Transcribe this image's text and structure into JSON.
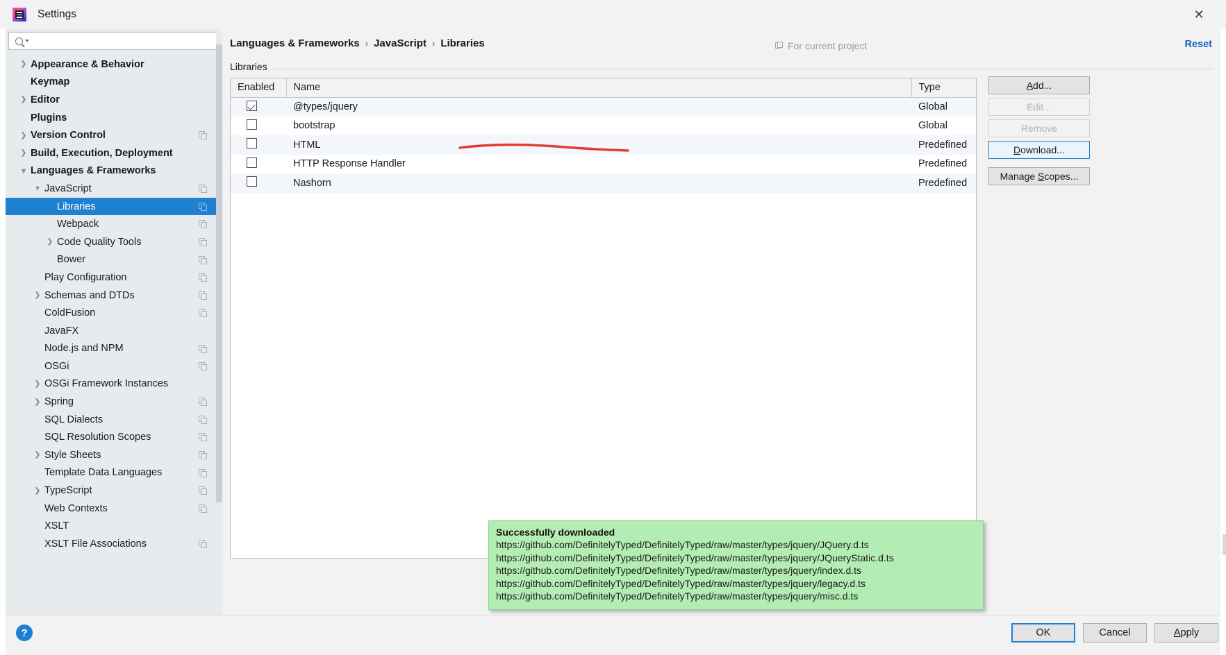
{
  "window": {
    "title": "Settings",
    "app_icon": "intellij-icon",
    "close_label": "✕"
  },
  "search": {
    "value": "",
    "placeholder": "",
    "icon": "search-icon"
  },
  "sidebar": {
    "items": [
      {
        "label": "Appearance & Behavior",
        "level": 0,
        "arrow": "closed",
        "selected": false,
        "module_icon": false
      },
      {
        "label": "Keymap",
        "level": 0,
        "arrow": "none",
        "selected": false,
        "module_icon": false
      },
      {
        "label": "Editor",
        "level": 0,
        "arrow": "closed",
        "selected": false,
        "module_icon": false
      },
      {
        "label": "Plugins",
        "level": 0,
        "arrow": "none",
        "selected": false,
        "module_icon": false
      },
      {
        "label": "Version Control",
        "level": 0,
        "arrow": "closed",
        "selected": false,
        "module_icon": true
      },
      {
        "label": "Build, Execution, Deployment",
        "level": 0,
        "arrow": "closed",
        "selected": false,
        "module_icon": false
      },
      {
        "label": "Languages & Frameworks",
        "level": 0,
        "arrow": "open",
        "selected": false,
        "module_icon": false
      },
      {
        "label": "JavaScript",
        "level": 1,
        "arrow": "open",
        "selected": false,
        "module_icon": true
      },
      {
        "label": "Libraries",
        "level": 2,
        "arrow": "none",
        "selected": true,
        "module_icon": true
      },
      {
        "label": "Webpack",
        "level": 2,
        "arrow": "none",
        "selected": false,
        "module_icon": true
      },
      {
        "label": "Code Quality Tools",
        "level": 2,
        "arrow": "closed",
        "selected": false,
        "module_icon": true
      },
      {
        "label": "Bower",
        "level": 2,
        "arrow": "none",
        "selected": false,
        "module_icon": true
      },
      {
        "label": "Play Configuration",
        "level": 1,
        "arrow": "none",
        "selected": false,
        "module_icon": true
      },
      {
        "label": "Schemas and DTDs",
        "level": 1,
        "arrow": "closed",
        "selected": false,
        "module_icon": true
      },
      {
        "label": "ColdFusion",
        "level": 1,
        "arrow": "none",
        "selected": false,
        "module_icon": true
      },
      {
        "label": "JavaFX",
        "level": 1,
        "arrow": "none",
        "selected": false,
        "module_icon": false
      },
      {
        "label": "Node.js and NPM",
        "level": 1,
        "arrow": "none",
        "selected": false,
        "module_icon": true
      },
      {
        "label": "OSGi",
        "level": 1,
        "arrow": "none",
        "selected": false,
        "module_icon": true
      },
      {
        "label": "OSGi Framework Instances",
        "level": 1,
        "arrow": "closed",
        "selected": false,
        "module_icon": false
      },
      {
        "label": "Spring",
        "level": 1,
        "arrow": "closed",
        "selected": false,
        "module_icon": true
      },
      {
        "label": "SQL Dialects",
        "level": 1,
        "arrow": "none",
        "selected": false,
        "module_icon": true
      },
      {
        "label": "SQL Resolution Scopes",
        "level": 1,
        "arrow": "none",
        "selected": false,
        "module_icon": true
      },
      {
        "label": "Style Sheets",
        "level": 1,
        "arrow": "closed",
        "selected": false,
        "module_icon": true
      },
      {
        "label": "Template Data Languages",
        "level": 1,
        "arrow": "none",
        "selected": false,
        "module_icon": true
      },
      {
        "label": "TypeScript",
        "level": 1,
        "arrow": "closed",
        "selected": false,
        "module_icon": true
      },
      {
        "label": "Web Contexts",
        "level": 1,
        "arrow": "none",
        "selected": false,
        "module_icon": true
      },
      {
        "label": "XSLT",
        "level": 1,
        "arrow": "none",
        "selected": false,
        "module_icon": false
      },
      {
        "label": "XSLT File Associations",
        "level": 1,
        "arrow": "none",
        "selected": false,
        "module_icon": true
      }
    ]
  },
  "header": {
    "breadcrumb": [
      "Languages & Frameworks",
      "JavaScript",
      "Libraries"
    ],
    "separator": "›",
    "scope_hint": "For current project",
    "scope_hint_icon": "project-icon",
    "reset_label": "Reset"
  },
  "main": {
    "section_label": "Libraries",
    "table": {
      "columns": [
        "Enabled",
        "Name",
        "Type"
      ],
      "rows": [
        {
          "enabled": true,
          "name": "@types/jquery",
          "type": "Global"
        },
        {
          "enabled": false,
          "name": "bootstrap",
          "type": "Global"
        },
        {
          "enabled": false,
          "name": "HTML",
          "type": "Predefined"
        },
        {
          "enabled": false,
          "name": "HTTP Response Handler",
          "type": "Predefined"
        },
        {
          "enabled": false,
          "name": "Nashorn",
          "type": "Predefined"
        }
      ]
    },
    "side_buttons": [
      {
        "label": "Add...",
        "mnemonic": "A",
        "state": "normal"
      },
      {
        "label": "Edit...",
        "mnemonic": "",
        "state": "disabled"
      },
      {
        "label": "Remove",
        "mnemonic": "",
        "state": "disabled"
      },
      {
        "label": "Download...",
        "mnemonic": "D",
        "state": "focused"
      },
      {
        "label": "Manage Scopes...",
        "mnemonic": "S",
        "state": "normal"
      }
    ]
  },
  "notification": {
    "title": "Successfully downloaded",
    "lines": [
      "https://github.com/DefinitelyTyped/DefinitelyTyped/raw/master/types/jquery/JQuery.d.ts",
      "https://github.com/DefinitelyTyped/DefinitelyTyped/raw/master/types/jquery/JQueryStatic.d.ts",
      "https://github.com/DefinitelyTyped/DefinitelyTyped/raw/master/types/jquery/index.d.ts",
      "https://github.com/DefinitelyTyped/DefinitelyTyped/raw/master/types/jquery/legacy.d.ts",
      "https://github.com/DefinitelyTyped/DefinitelyTyped/raw/master/types/jquery/misc.d.ts"
    ],
    "background_color": "#b3edb3"
  },
  "footer": {
    "help_label": "?",
    "ok_label": "OK",
    "cancel_label": "Cancel",
    "apply_label": "Apply",
    "apply_mnemonic": "A"
  },
  "colors": {
    "accent": "#1f7fd0",
    "link": "#1565c0",
    "sidebar_bg": "#e7ebee",
    "panel_bg": "#f2f2f2",
    "annotation_red": "#e23b32"
  }
}
